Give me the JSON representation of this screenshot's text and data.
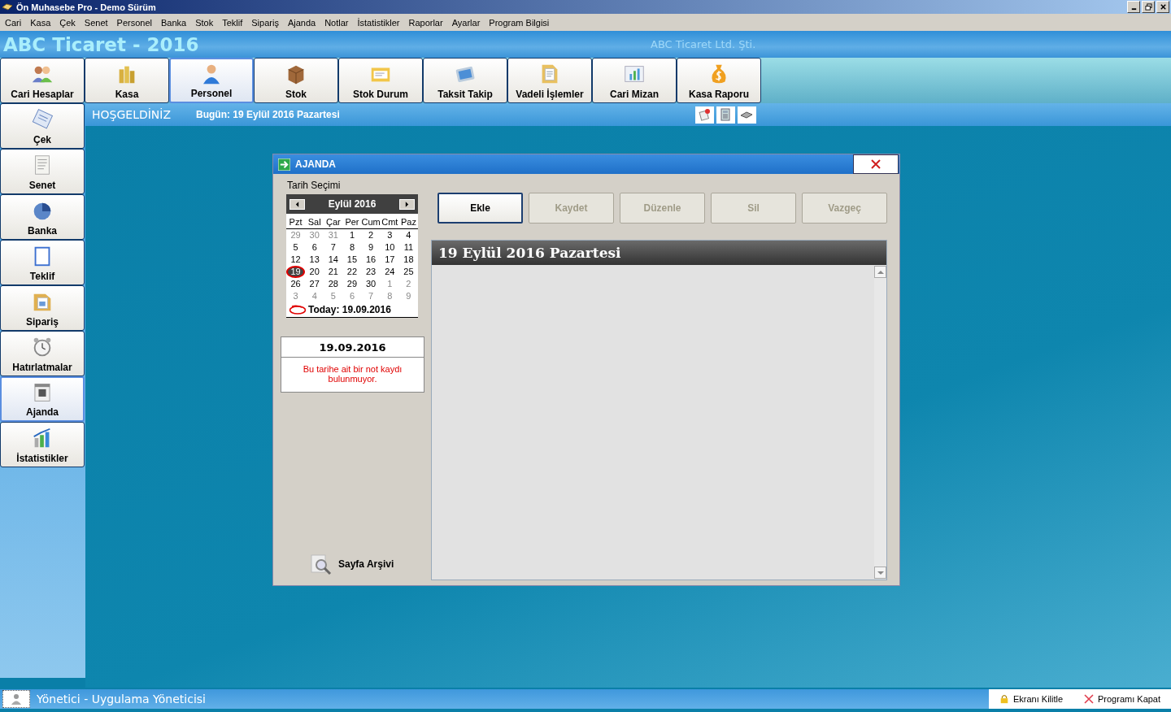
{
  "window": {
    "title": "Ön Muhasebe Pro - Demo Sürüm"
  },
  "menu": [
    "Cari",
    "Kasa",
    "Çek",
    "Senet",
    "Personel",
    "Banka",
    "Stok",
    "Teklif",
    "Sipariş",
    "Ajanda",
    "Notlar",
    "İstatistikler",
    "Raporlar",
    "Ayarlar",
    "Program Bilgisi"
  ],
  "header": {
    "app_title": "ABC Ticaret - 2016",
    "company": "ABC Ticaret Ltd. Şti."
  },
  "toolbar": [
    {
      "label": "Cari Hesaplar",
      "kind": "people",
      "selected": false
    },
    {
      "label": "Kasa",
      "kind": "coins",
      "selected": false
    },
    {
      "label": "Personel",
      "kind": "person",
      "selected": true
    },
    {
      "label": "Stok",
      "kind": "box",
      "selected": false
    },
    {
      "label": "Stok Durum",
      "kind": "folder",
      "selected": false
    },
    {
      "label": "Taksit Takip",
      "kind": "tablet",
      "selected": false
    },
    {
      "label": "Vadeli İşlemler",
      "kind": "folder2",
      "selected": false
    },
    {
      "label": "Cari Mizan",
      "kind": "chart",
      "selected": false
    },
    {
      "label": "Kasa Raporu",
      "kind": "moneybag",
      "selected": false
    }
  ],
  "sidebar": [
    {
      "label": "Çek",
      "kind": "notepad",
      "selected": false
    },
    {
      "label": "Senet",
      "kind": "document",
      "selected": false
    },
    {
      "label": "Banka",
      "kind": "pie",
      "selected": false
    },
    {
      "label": "Teklif",
      "kind": "clipboard",
      "selected": false
    },
    {
      "label": "Sipariş",
      "kind": "folder2",
      "selected": false
    },
    {
      "label": "Hatırlatmalar",
      "kind": "clock",
      "selected": false
    },
    {
      "label": "Ajanda",
      "kind": "calendar",
      "selected": true
    },
    {
      "label": "İstatistikler",
      "kind": "chart",
      "selected": false
    }
  ],
  "welcome_bar": {
    "greeting": "HOŞGELDİNİZ",
    "today": "Bugün: 19 Eylül 2016 Pazartesi"
  },
  "dialog": {
    "title": "AJANDA",
    "date_label": "Tarih Seçimi",
    "calendar": {
      "month": "Eylül 2016",
      "weekdays": [
        "Pzt",
        "Sal",
        "Çar",
        "Per",
        "Cum",
        "Cmt",
        "Paz"
      ],
      "weeks": [
        [
          {
            "day": "29",
            "other_month": true,
            "today": false
          },
          {
            "day": "30",
            "other_month": true,
            "today": false
          },
          {
            "day": "31",
            "other_month": true,
            "today": false
          },
          {
            "day": "1",
            "other_month": false,
            "today": false
          },
          {
            "day": "2",
            "other_month": false,
            "today": false
          },
          {
            "day": "3",
            "other_month": false,
            "today": false
          },
          {
            "day": "4",
            "other_month": false,
            "today": false
          }
        ],
        [
          {
            "day": "5",
            "other_month": false,
            "today": false
          },
          {
            "day": "6",
            "other_month": false,
            "today": false
          },
          {
            "day": "7",
            "other_month": false,
            "today": false
          },
          {
            "day": "8",
            "other_month": false,
            "today": false
          },
          {
            "day": "9",
            "other_month": false,
            "today": false
          },
          {
            "day": "10",
            "other_month": false,
            "today": false
          },
          {
            "day": "11",
            "other_month": false,
            "today": false
          }
        ],
        [
          {
            "day": "12",
            "other_month": false,
            "today": false
          },
          {
            "day": "13",
            "other_month": false,
            "today": false
          },
          {
            "day": "14",
            "other_month": false,
            "today": false
          },
          {
            "day": "15",
            "other_month": false,
            "today": false
          },
          {
            "day": "16",
            "other_month": false,
            "today": false
          },
          {
            "day": "17",
            "other_month": false,
            "today": false
          },
          {
            "day": "18",
            "other_month": false,
            "today": false
          }
        ],
        [
          {
            "day": "19",
            "other_month": false,
            "today": true
          },
          {
            "day": "20",
            "other_month": false,
            "today": false
          },
          {
            "day": "21",
            "other_month": false,
            "today": false
          },
          {
            "day": "22",
            "other_month": false,
            "today": false
          },
          {
            "day": "23",
            "other_month": false,
            "today": false
          },
          {
            "day": "24",
            "other_month": false,
            "today": false
          },
          {
            "day": "25",
            "other_month": false,
            "today": false
          }
        ],
        [
          {
            "day": "26",
            "other_month": false,
            "today": false
          },
          {
            "day": "27",
            "other_month": false,
            "today": false
          },
          {
            "day": "28",
            "other_month": false,
            "today": false
          },
          {
            "day": "29",
            "other_month": false,
            "today": false
          },
          {
            "day": "30",
            "other_month": false,
            "today": false
          },
          {
            "day": "1",
            "other_month": true,
            "today": false
          },
          {
            "day": "2",
            "other_month": true,
            "today": false
          }
        ],
        [
          {
            "day": "3",
            "other_month": true,
            "today": false
          },
          {
            "day": "4",
            "other_month": true,
            "today": false
          },
          {
            "day": "5",
            "other_month": true,
            "today": false
          },
          {
            "day": "6",
            "other_month": true,
            "today": false
          },
          {
            "day": "7",
            "other_month": true,
            "today": false
          },
          {
            "day": "8",
            "other_month": true,
            "today": false
          },
          {
            "day": "9",
            "other_month": true,
            "today": false
          }
        ]
      ],
      "today_text": "Today: 19.09.2016"
    },
    "note_date": "19.09.2016",
    "note_message": "Bu tarihe ait bir not kaydı bulunmuyor.",
    "archive": "Sayfa Arşivi",
    "buttons": [
      {
        "label": "Ekle",
        "disabled": false
      },
      {
        "label": "Kaydet",
        "disabled": true
      },
      {
        "label": "Düzenle",
        "disabled": true
      },
      {
        "label": "Sil",
        "disabled": true
      },
      {
        "label": "Vazgeç",
        "disabled": true
      }
    ],
    "page_title": "19 Eylül 2016 Pazartesi"
  },
  "status_bar": {
    "user": "Yönetici - Uygulama Yöneticisi",
    "lock": "Ekranı Kilitle",
    "close": "Programı Kapat"
  }
}
